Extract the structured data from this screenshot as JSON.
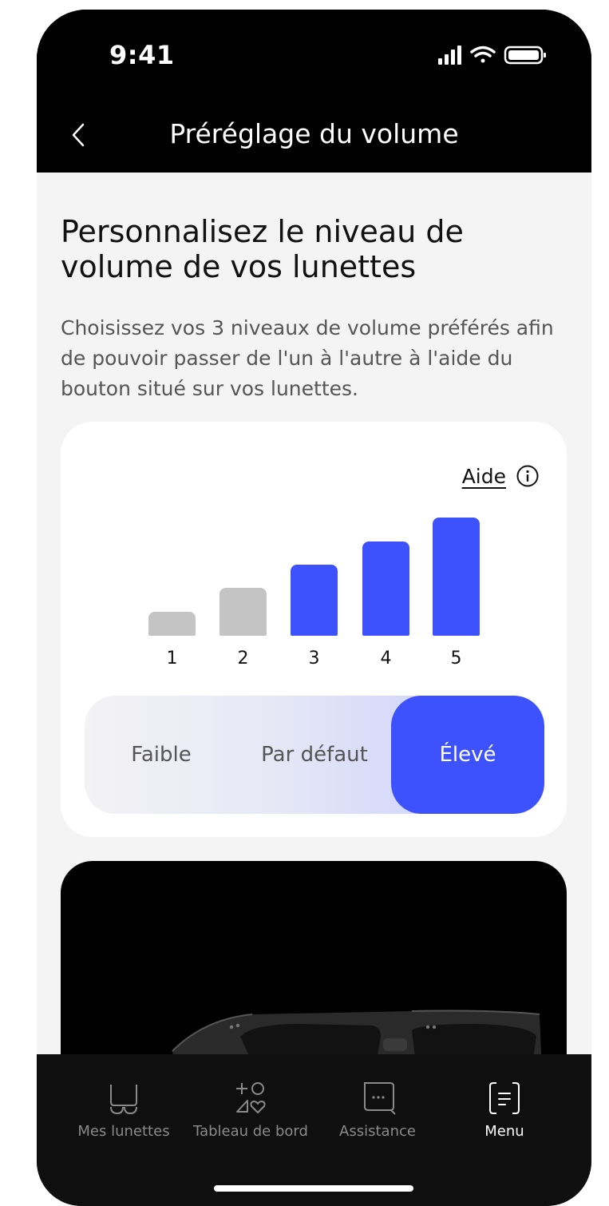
{
  "status_bar": {
    "time": "9:41"
  },
  "nav": {
    "title": "Préréglage du volume"
  },
  "headline": "Personnalisez le niveau de volume de vos lunettes",
  "description": "Choisissez vos 3 niveaux de volume préférés afin de pouvoir passer de l'un à l'autre à l'aide du bouton situé sur vos lunettes.",
  "card": {
    "help_label": "Aide",
    "levels": [
      {
        "label": "1",
        "active": false
      },
      {
        "label": "2",
        "active": false
      },
      {
        "label": "3",
        "active": true
      },
      {
        "label": "4",
        "active": true
      },
      {
        "label": "5",
        "active": true
      }
    ],
    "presets": [
      "Faible",
      "Par défaut",
      "Élevé"
    ],
    "selected_preset": "Élevé"
  },
  "tabbar": {
    "items": [
      {
        "label": "Mes lunettes",
        "icon": "glasses-icon",
        "active": false
      },
      {
        "label": "Tableau de bord",
        "icon": "dashboard-icon",
        "active": false
      },
      {
        "label": "Assistance",
        "icon": "chat-icon",
        "active": false
      },
      {
        "label": "Menu",
        "icon": "menu-icon",
        "active": true
      }
    ]
  },
  "colors": {
    "accent": "#3D52FC",
    "inactive_bar": "#C4C4C4",
    "background": "#F4F4F4"
  }
}
